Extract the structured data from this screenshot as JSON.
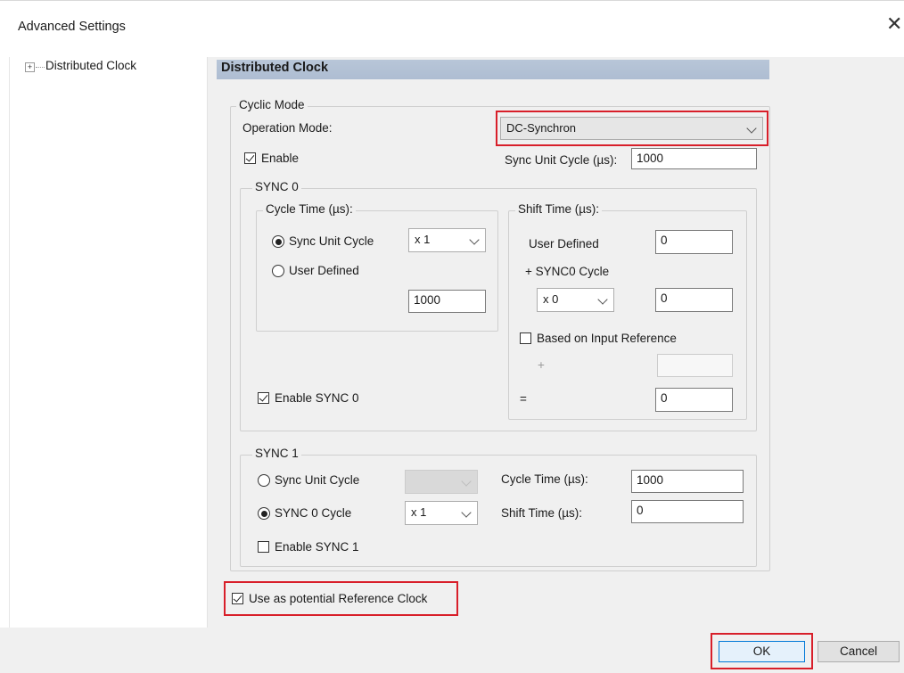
{
  "window": {
    "title": "Advanced Settings",
    "close_glyph": "✕"
  },
  "tree": {
    "expander": "+",
    "item": "Distributed Clock"
  },
  "panel": {
    "header": "Distributed Clock",
    "cyclic_mode": {
      "legend": "Cyclic Mode",
      "operation_mode_label": "Operation Mode:",
      "operation_mode_value": "DC-Synchron",
      "enable_label": "Enable",
      "enable_checked": true,
      "sync_unit_cycle_label": "Sync Unit Cycle (µs):",
      "sync_unit_cycle_value": "1000"
    },
    "sync0": {
      "legend": "SYNC 0",
      "cycle_time": {
        "legend": "Cycle Time (µs):",
        "sync_unit_cycle_label": "Sync Unit Cycle",
        "multiplier": "x 1",
        "user_defined_label": "User Defined",
        "value": "1000"
      },
      "shift_time": {
        "legend": "Shift Time (µs):",
        "user_defined_label": "User Defined",
        "user_defined_value": "0",
        "plus_sync0_label": "+ SYNC0 Cycle",
        "multiplier": "x 0",
        "multiplier_value": "0",
        "based_on_input_label": "Based on Input Reference",
        "plus_sign": "+",
        "plus_value": "",
        "equals_sign": "=",
        "result_value": "0"
      },
      "enable_label": "Enable SYNC 0",
      "enable_checked": true
    },
    "sync1": {
      "legend": "SYNC 1",
      "sync_unit_cycle_label": "Sync Unit Cycle",
      "sync0_cycle_label": "SYNC 0 Cycle",
      "multiplier": "x 1",
      "enable_label": "Enable SYNC 1",
      "cycle_time_label": "Cycle Time (µs):",
      "cycle_time_value": "1000",
      "shift_time_label": "Shift Time (µs):",
      "shift_time_value": "0"
    },
    "reference_clock_label": "Use as potential Reference Clock",
    "reference_clock_checked": true
  },
  "footer": {
    "ok_label": "OK",
    "cancel_label": "Cancel"
  },
  "colors": {
    "highlight": "#d81f2a",
    "header_bg": "#b8c6d8",
    "panel_bg": "#f0f0f0"
  }
}
